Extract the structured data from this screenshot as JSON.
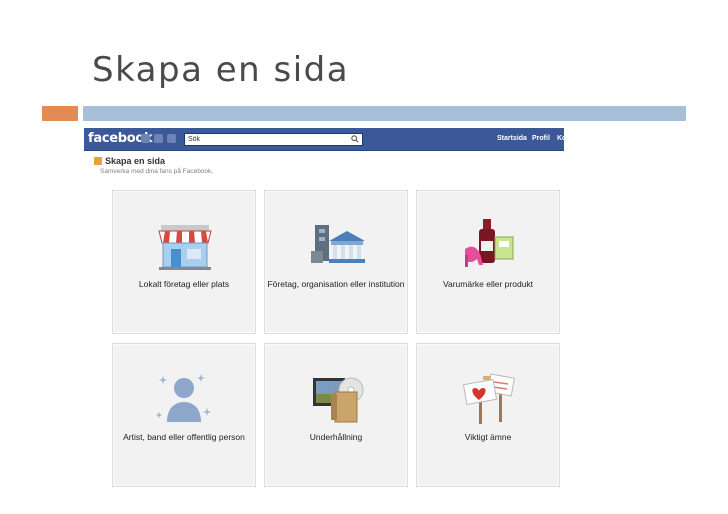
{
  "slide": {
    "title": "Skapa en sida"
  },
  "facebook": {
    "logo": "facebook",
    "search_value": "Sök",
    "nav": [
      "Startsida",
      "Profil",
      "Ko"
    ]
  },
  "create_page": {
    "title": "Skapa en sida",
    "subtitle": "Samverka med dina fans på Facebook."
  },
  "tiles": [
    {
      "label": "Lokalt företag eller plats",
      "icon": "storefront-icon"
    },
    {
      "label": "Företag, organisation eller institution",
      "icon": "building-icon"
    },
    {
      "label": "Varumärke eller produkt",
      "icon": "products-icon"
    },
    {
      "label": "Artist, band eller offentlig person",
      "icon": "person-icon"
    },
    {
      "label": "Underhållning",
      "icon": "entertainment-icon"
    },
    {
      "label": "Viktigt ämne",
      "icon": "signs-icon"
    }
  ],
  "colors": {
    "facebook_blue": "#3b5998",
    "accent_orange": "#e38b55",
    "accent_blue": "#a7bfd9",
    "tile_bg": "#f2f2f2"
  }
}
